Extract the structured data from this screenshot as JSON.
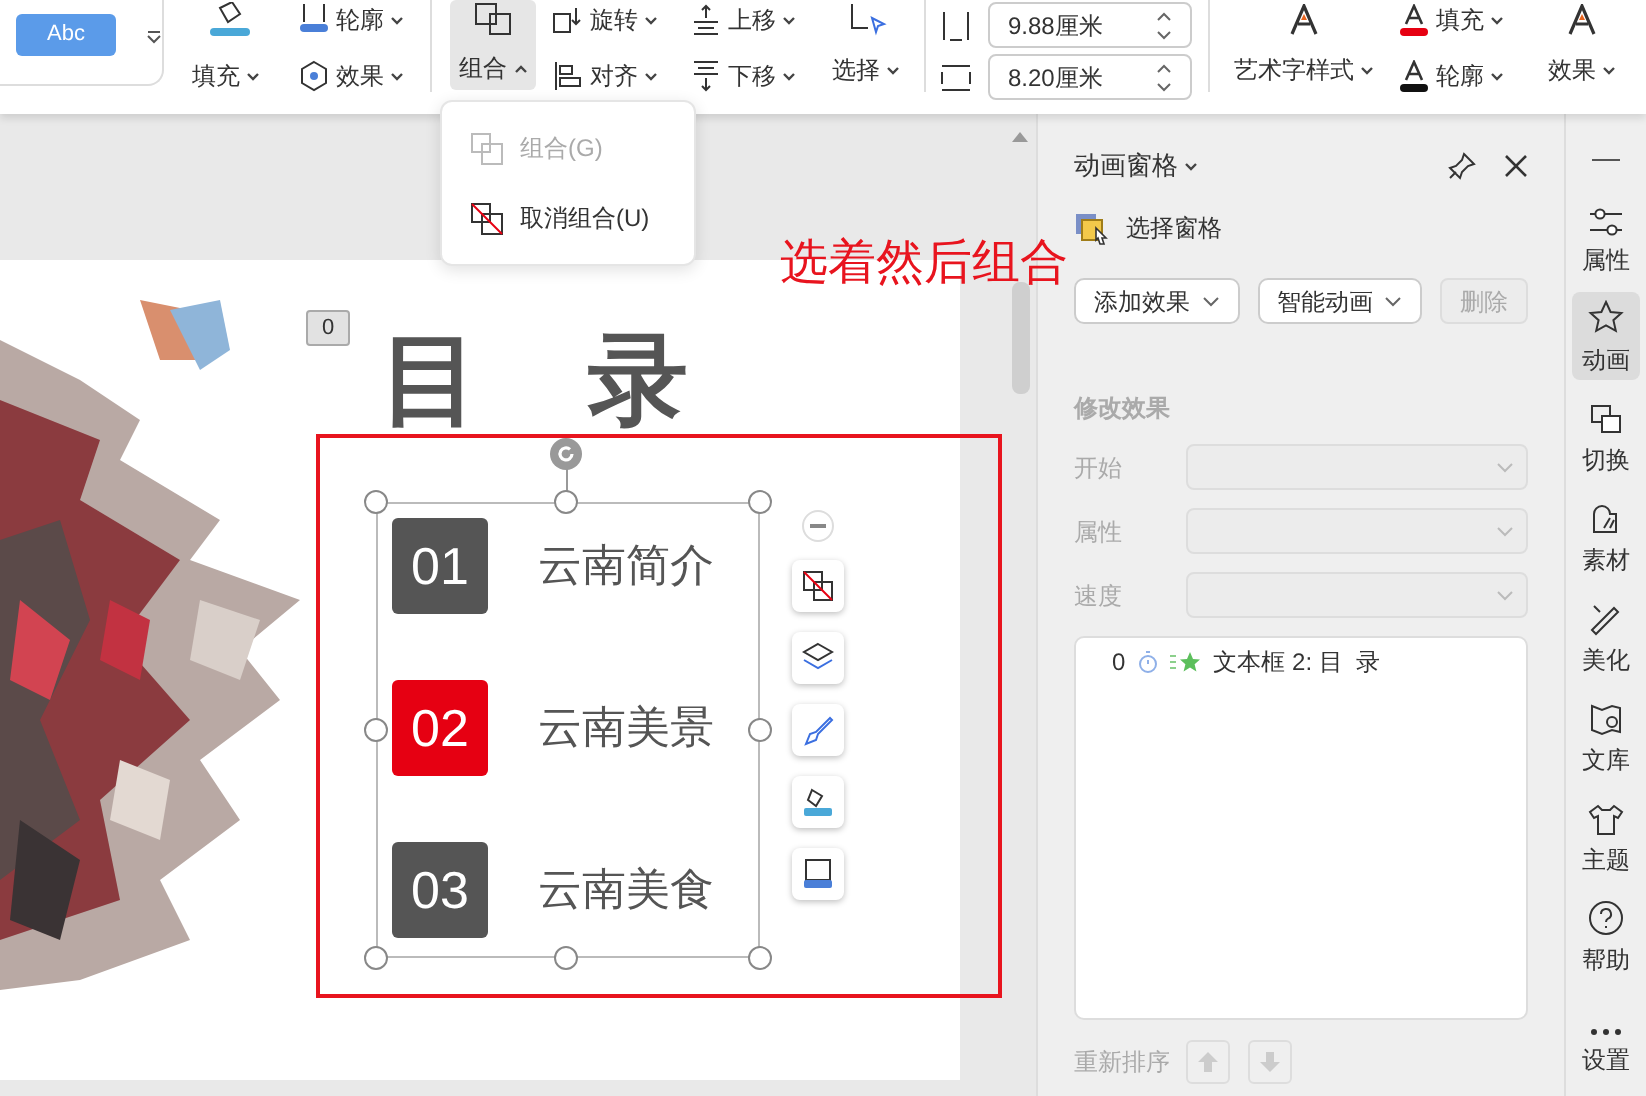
{
  "ribbon": {
    "style_sample": "Abc",
    "shape_outline": "轮廓",
    "shape_fill": "填充",
    "shape_effect": "效果",
    "group_button": {
      "label": "组合",
      "expanded": true
    },
    "arrange": [
      {
        "label": "旋转"
      },
      {
        "label": "对齐"
      },
      {
        "label": "上移"
      },
      {
        "label": "下移"
      }
    ],
    "select": "选择",
    "width": "9.88厘米",
    "height": "8.20厘米",
    "wordart": {
      "style": "艺术字样式",
      "fill": "填充",
      "outline": "轮廓",
      "effect": "效果"
    }
  },
  "group_menu": [
    {
      "label": "组合(G)",
      "disabled": true
    },
    {
      "label": "取消组合(U)",
      "disabled": false
    }
  ],
  "annotation": "选着然后组合",
  "slide": {
    "badge": "0",
    "title": "目 录",
    "items": [
      {
        "number": "01",
        "label": "云南简介",
        "color": "#555555"
      },
      {
        "number": "02",
        "label": "云南美景",
        "color": "#e60012"
      },
      {
        "number": "03",
        "label": "云南美食",
        "color": "#555555"
      }
    ]
  },
  "animation_pane": {
    "title": "动画窗格",
    "selection_pane": "选择窗格",
    "buttons": [
      {
        "label": "添加效果",
        "kind": "dropdown",
        "disabled": false
      },
      {
        "label": "智能动画",
        "kind": "dropdown",
        "disabled": false
      },
      {
        "label": "删除",
        "kind": "plain",
        "disabled": true
      }
    ],
    "section": "修改效果",
    "fields": [
      {
        "label": "开始",
        "disabled": true
      },
      {
        "label": "属性",
        "disabled": true
      },
      {
        "label": "速度",
        "disabled": true
      }
    ],
    "list": [
      {
        "index": "0",
        "name": "文本框 2: 目  录"
      }
    ],
    "reorder": "重新排序"
  },
  "sidebar": [
    {
      "label": "属性",
      "selected": false
    },
    {
      "label": "动画",
      "selected": true
    },
    {
      "label": "切换",
      "selected": false
    },
    {
      "label": "素材",
      "selected": false
    },
    {
      "label": "美化",
      "selected": false
    },
    {
      "label": "文库",
      "selected": false
    },
    {
      "label": "主题",
      "selected": false
    },
    {
      "label": "帮助",
      "selected": false
    },
    {
      "label": "设置",
      "selected": false
    }
  ]
}
